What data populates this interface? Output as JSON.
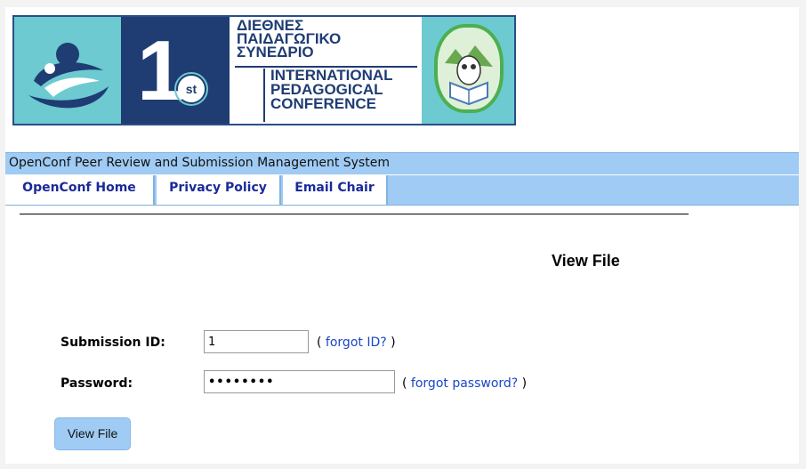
{
  "banner": {
    "greek_line1": "ΔΙΕΘΝΕΣ",
    "greek_line2": "ΠΑΙΔΑΓΩΓΙΚΟ",
    "greek_line3": "ΣΥΝΕΔΡΙΟ",
    "eng_line1": "INTERNATIONAL",
    "eng_line2": "PEDAGOGICAL",
    "eng_line3": "CONFERENCE",
    "number": "1",
    "ordinal": "st",
    "colors": {
      "teal": "#6ccad0",
      "navy": "#1f3c73"
    }
  },
  "header": {
    "system_title": "OpenConf Peer Review and Submission Management System",
    "nav": [
      {
        "label": "OpenConf Home"
      },
      {
        "label": "Privacy Policy"
      },
      {
        "label": "Email Chair"
      }
    ],
    "bar_color": "#9fcbf4"
  },
  "main": {
    "title": "View File",
    "submission_id_label": "Submission ID:",
    "submission_id_value": "1",
    "forgot_id_open": "( ",
    "forgot_id_link": "forgot ID?",
    "forgot_id_close": " )",
    "password_label": "Password:",
    "password_value": "••••••••",
    "forgot_pw_open": "( ",
    "forgot_pw_link": "forgot password?",
    "forgot_pw_close": " )",
    "submit_label": "View File"
  }
}
